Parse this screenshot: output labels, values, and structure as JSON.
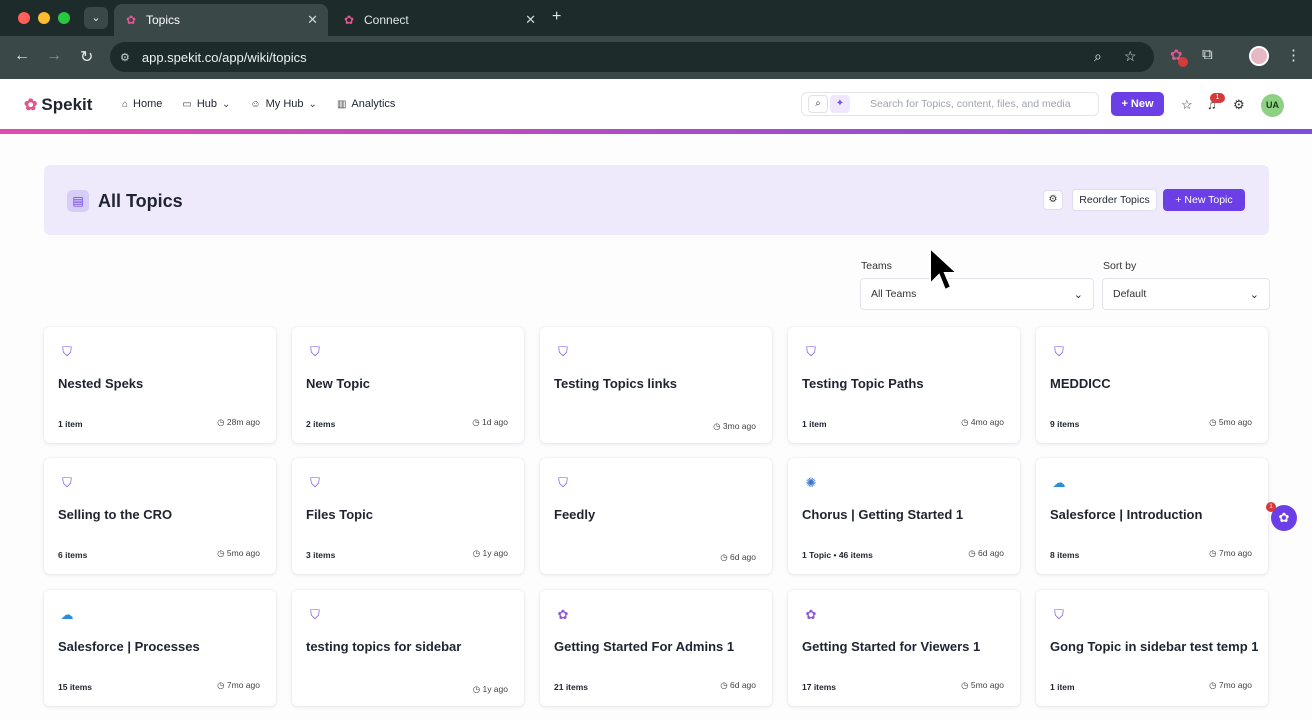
{
  "browser": {
    "tabs": [
      {
        "title": "Topics",
        "close": "✕"
      },
      {
        "title": "Connect",
        "close": "✕"
      }
    ],
    "new_tab": "+",
    "url": "app.spekit.co/app/wiki/topics",
    "traffic_colors": [
      "#ff5f57",
      "#febc2e",
      "#28c840"
    ]
  },
  "header": {
    "logo": "Spekit",
    "nav": [
      {
        "label": "Home",
        "icon": "home-icon"
      },
      {
        "label": "Hub",
        "icon": "folder-icon",
        "chevron": "⌄"
      },
      {
        "label": "My Hub",
        "icon": "user-icon",
        "chevron": "⌄"
      },
      {
        "label": "Analytics",
        "icon": "chart-icon"
      }
    ],
    "search_placeholder": "Search for Topics, content, files, and media",
    "new_label": "+ New",
    "bell_badge": "1",
    "avatar": "UA"
  },
  "banner": {
    "title": "All Topics",
    "reorder_label": "Reorder Topics",
    "new_topic_label": "+ New Topic"
  },
  "filters": {
    "teams_label": "Teams",
    "teams_value": "All Teams",
    "sort_label": "Sort by",
    "sort_value": "Default"
  },
  "topics": [
    {
      "title": "Nested Speks",
      "count": "1 item",
      "time": "28m ago",
      "icon": "bookmark-icon"
    },
    {
      "title": "New Topic",
      "count": "2 items",
      "time": "1d ago",
      "icon": "bookmark-icon"
    },
    {
      "title": "Testing Topics links",
      "count": "",
      "time": "3mo ago",
      "icon": "bookmark-icon"
    },
    {
      "title": "Testing Topic Paths",
      "count": "1 item",
      "time": "4mo ago",
      "icon": "bookmark-icon"
    },
    {
      "title": "MEDDICC",
      "count": "9 items",
      "time": "5mo ago",
      "icon": "bookmark-icon"
    },
    {
      "title": "Selling to the CRO",
      "count": "6 items",
      "time": "5mo ago",
      "icon": "bookmark-icon"
    },
    {
      "title": "Files Topic",
      "count": "3 items",
      "time": "1y ago",
      "icon": "bookmark-icon"
    },
    {
      "title": "Feedly",
      "count": "",
      "time": "6d ago",
      "icon": "bookmark-icon"
    },
    {
      "title": "Chorus | Getting Started 1",
      "count": "1 Topic  •  46 items",
      "time": "6d ago",
      "icon": "chorus-icon"
    },
    {
      "title": "Salesforce | Introduction",
      "count": "8 items",
      "time": "7mo ago",
      "icon": "salesforce-icon"
    },
    {
      "title": "Salesforce | Processes",
      "count": "15 items",
      "time": "7mo ago",
      "icon": "salesforce-icon"
    },
    {
      "title": "testing topics for sidebar",
      "count": "",
      "time": "1y ago",
      "icon": "bookmark-icon"
    },
    {
      "title": "Getting Started For Admins 1",
      "count": "21 items",
      "time": "6d ago",
      "icon": "spekit-icon"
    },
    {
      "title": "Getting Started for Viewers 1",
      "count": "17 items",
      "time": "5mo ago",
      "icon": "spekit-icon"
    },
    {
      "title": "Gong Topic in sidebar test temp 1",
      "count": "1 item",
      "time": "7mo ago",
      "icon": "bookmark-icon"
    }
  ],
  "float_badge": "1",
  "colors": {
    "accent": "#6c3fe6",
    "banner": "#eeeafb",
    "chrome": "#1d2b2b"
  }
}
